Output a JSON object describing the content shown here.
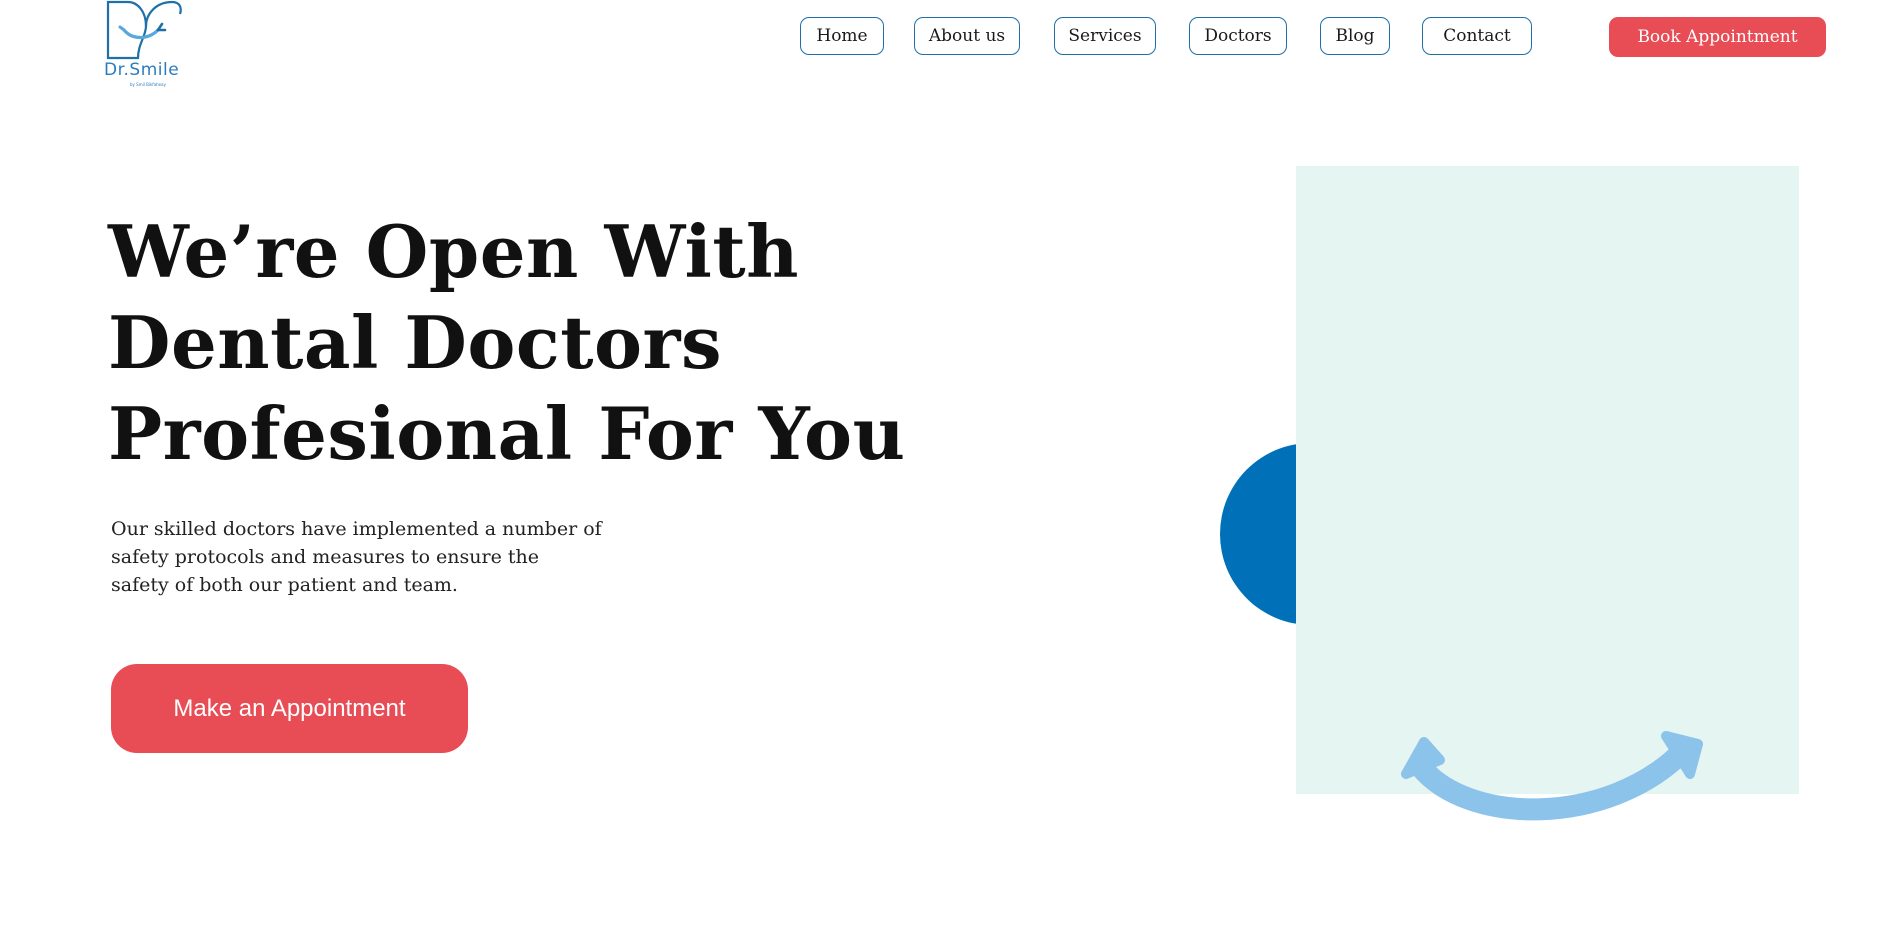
{
  "logo": {
    "name": "Dr.Smile",
    "tagline": "by Smil Bikfaheay"
  },
  "nav": {
    "items": [
      {
        "label": "Home",
        "id": "home"
      },
      {
        "label": "About us",
        "id": "about"
      },
      {
        "label": "Services",
        "id": "services"
      },
      {
        "label": "Doctors",
        "id": "doctors"
      },
      {
        "label": "Blog",
        "id": "blog"
      },
      {
        "label": "Contact",
        "id": "contact"
      }
    ],
    "book_label": "Book Appointment"
  },
  "hero": {
    "title_line1": "We’re Open With",
    "title_line2": "Dental Doctors",
    "title_line3": "Profesional For You",
    "desc_line1": "Our skilled doctors have implemented a number of",
    "desc_line2": "safety protocols and measures to ensure the",
    "desc_line3": "safety of both our patient and team.",
    "cta_label": "Make an Appointment"
  },
  "colors": {
    "accent_red": "#e84c55",
    "brand_blue": "#0071b8",
    "smile_blue": "#8cc3ea",
    "panel_mint": "#e5f5f1",
    "nav_border": "#1f6fa8"
  },
  "icons": {
    "logo": "tooth-smile-logo-icon",
    "decoration": "smile-arc-icon"
  }
}
